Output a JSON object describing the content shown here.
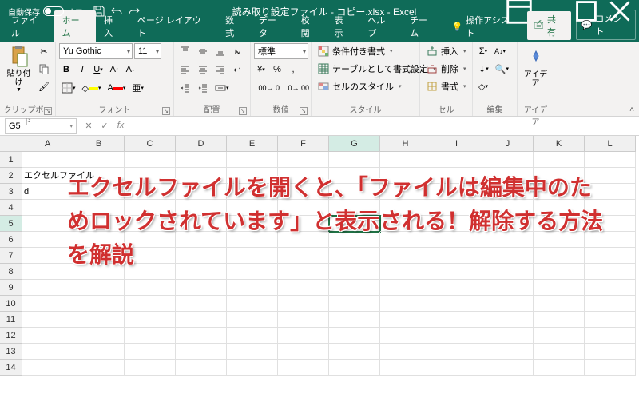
{
  "titlebar": {
    "autosave_label": "自動保存",
    "autosave_state": "オフ",
    "title": "読み取り設定ファイル - コピー.xlsx  -  Excel"
  },
  "tabs": {
    "file": "ファイル",
    "home": "ホーム",
    "insert": "挿入",
    "pagelayout": "ページ レイアウト",
    "formulas": "数式",
    "data": "データ",
    "review": "校閲",
    "view": "表示",
    "help": "ヘルプ",
    "team": "チーム",
    "tellme": "操作アシスト",
    "share": "共有",
    "comment": "コメント"
  },
  "ribbon": {
    "clipboard": {
      "paste": "貼り付け",
      "label": "クリップボード"
    },
    "font": {
      "name": "Yu Gothic",
      "size": "11",
      "label": "フォント"
    },
    "alignment": {
      "label": "配置"
    },
    "number": {
      "format": "標準",
      "label": "数値"
    },
    "styles": {
      "cond": "条件付き書式",
      "table": "テーブルとして書式設定",
      "cell": "セルのスタイル",
      "label": "スタイル"
    },
    "cells": {
      "insert": "挿入",
      "delete": "削除",
      "format": "書式",
      "label": "セル"
    },
    "editing": {
      "label": "編集"
    },
    "ideas": {
      "btn": "アイデア",
      "label": "アイデア"
    }
  },
  "formula": {
    "namebox": "G5"
  },
  "grid": {
    "cols": [
      "A",
      "B",
      "C",
      "D",
      "E",
      "F",
      "G",
      "H",
      "I",
      "J",
      "K",
      "L"
    ],
    "rows": [
      "1",
      "2",
      "3",
      "4",
      "5",
      "6",
      "7",
      "8",
      "9",
      "10",
      "11",
      "12",
      "13",
      "14"
    ],
    "active": "G5",
    "cells": {
      "A2": "エクセルファイル",
      "A3": "d"
    }
  },
  "overlay": "エクセルファイルを開くと、「ファイルは編集中のためロックされています」と表示される！解除する方法を解説"
}
